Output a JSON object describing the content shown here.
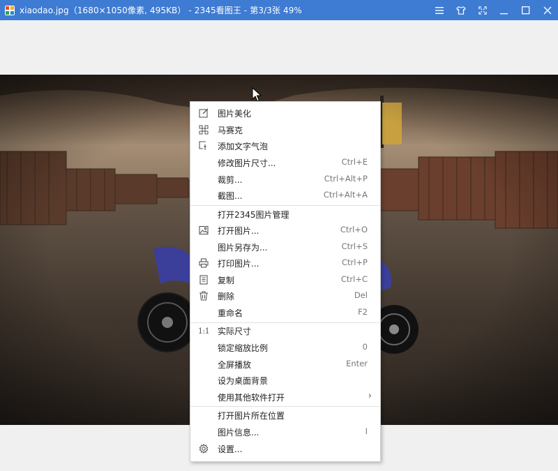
{
  "titlebar": {
    "title": "xiaodao.jpg（1680×1050像素, 495KB） - 2345看图王 - 第3/3张 49%",
    "buttons": [
      "menu-icon",
      "skin-icon",
      "fullscreen-icon",
      "minimize-icon",
      "maximize-icon",
      "close-icon"
    ]
  },
  "menu": {
    "items": [
      {
        "label": "图片美化",
        "shortcut": "",
        "icon": "edit-icon"
      },
      {
        "label": "马赛克",
        "shortcut": "",
        "icon": "mosaic-icon"
      },
      {
        "label": "添加文字气泡",
        "shortcut": "",
        "icon": "text-bubble-icon"
      },
      {
        "label": "修改图片尺寸...",
        "shortcut": "Ctrl+E",
        "icon": ""
      },
      {
        "label": "裁剪...",
        "shortcut": "Ctrl+Alt+P",
        "icon": ""
      },
      {
        "label": "截图...",
        "shortcut": "Ctrl+Alt+A",
        "icon": ""
      },
      {
        "label": "打开2345图片管理",
        "shortcut": "",
        "icon": ""
      },
      {
        "label": "打开图片...",
        "shortcut": "Ctrl+O",
        "icon": "image-icon"
      },
      {
        "label": "图片另存为...",
        "shortcut": "Ctrl+S",
        "icon": ""
      },
      {
        "label": "打印图片...",
        "shortcut": "Ctrl+P",
        "icon": "printer-icon"
      },
      {
        "label": "复制",
        "shortcut": "Ctrl+C",
        "icon": "copy-icon"
      },
      {
        "label": "删除",
        "shortcut": "Del",
        "icon": "trash-icon"
      },
      {
        "label": "重命名",
        "shortcut": "F2",
        "icon": ""
      },
      {
        "label": "实际尺寸",
        "shortcut": "",
        "icon": "actual-size-icon",
        "icon_text": "1:1"
      },
      {
        "label": "锁定缩放比例",
        "shortcut": "0",
        "icon": ""
      },
      {
        "label": "全屏播放",
        "shortcut": "Enter",
        "icon": ""
      },
      {
        "label": "设为桌面背景",
        "shortcut": "",
        "icon": ""
      },
      {
        "label": "使用其他软件打开",
        "shortcut": "",
        "icon": "",
        "submenu": true
      },
      {
        "label": "打开图片所在位置",
        "shortcut": "",
        "icon": ""
      },
      {
        "label": "图片信息...",
        "shortcut": "I",
        "icon": ""
      },
      {
        "label": "设置...",
        "shortcut": "",
        "icon": "gear-icon"
      }
    ]
  },
  "colors": {
    "titlebar": "#3e7bd3",
    "background": "#f0f0f0"
  }
}
